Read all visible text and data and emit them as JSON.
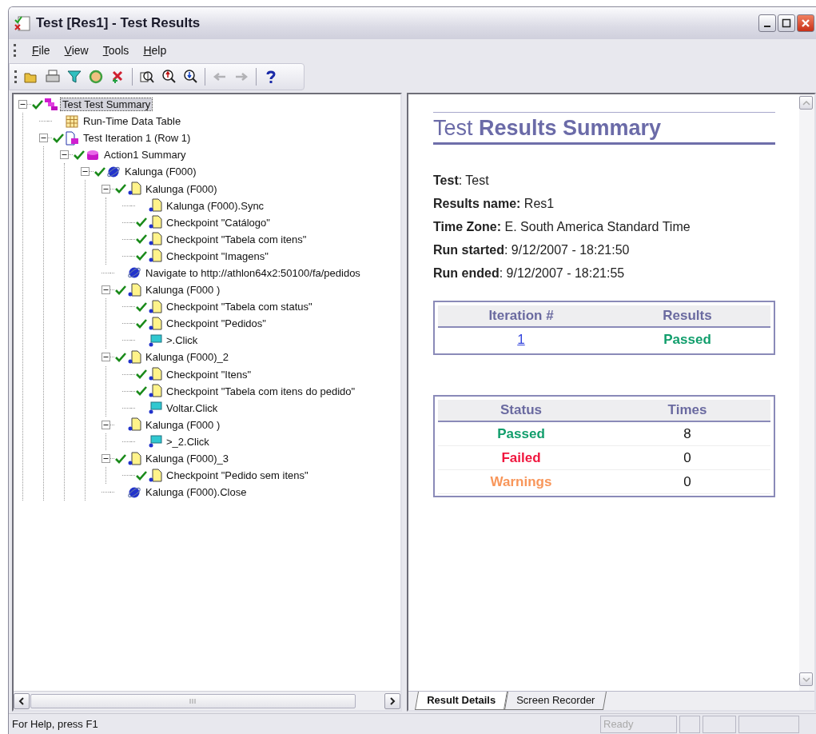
{
  "window": {
    "title": "Test [Res1] - Test Results"
  },
  "menu": [
    {
      "label": "File",
      "underline_first": true
    },
    {
      "label": "View",
      "underline_first": true
    },
    {
      "label": "Tools",
      "underline_first": true
    },
    {
      "label": "Help",
      "underline_first": true
    }
  ],
  "toolbar": [
    {
      "kind": "open",
      "disabled": false
    },
    {
      "kind": "print",
      "disabled": false
    },
    {
      "kind": "filter",
      "disabled": false
    },
    {
      "kind": "target",
      "disabled": false
    },
    {
      "kind": "remove",
      "disabled": false
    },
    {
      "kind": "find",
      "disabled": false
    },
    {
      "kind": "zoom-up",
      "disabled": false
    },
    {
      "kind": "zoom-down",
      "disabled": false
    },
    {
      "kind": "back",
      "disabled": true
    },
    {
      "kind": "forward",
      "disabled": true
    },
    {
      "kind": "help",
      "disabled": false
    }
  ],
  "tree": [
    {
      "label": "Test Test Summary",
      "kind": "summary",
      "passed": true,
      "selected": true,
      "expanded": true,
      "children": [
        {
          "label": "Run-Time Data Table",
          "kind": "table",
          "passed": false,
          "selected": false
        },
        {
          "label": "Test Iteration 1 (Row 1)",
          "kind": "iteration",
          "passed": true,
          "selected": false,
          "expanded": true,
          "children": [
            {
              "label": "Action1 Summary",
              "kind": "action",
              "passed": true,
              "selected": false,
              "expanded": true,
              "children": [
                {
                  "label": "Kalunga (F000)",
                  "kind": "browser",
                  "passed": true,
                  "selected": false,
                  "expanded": true,
                  "children": [
                    {
                      "label": "Kalunga (F000)",
                      "kind": "page",
                      "passed": true,
                      "selected": false,
                      "expanded": true,
                      "children": [
                        {
                          "label": "Kalunga (F000).Sync",
                          "kind": "page",
                          "passed": false,
                          "selected": false
                        },
                        {
                          "label": "Checkpoint \"Catálogo\"",
                          "kind": "page",
                          "passed": true,
                          "selected": false
                        },
                        {
                          "label": "Checkpoint \"Tabela com itens\"",
                          "kind": "page",
                          "passed": true,
                          "selected": false
                        },
                        {
                          "label": "Checkpoint \"Imagens\"",
                          "kind": "page",
                          "passed": true,
                          "selected": false
                        }
                      ]
                    },
                    {
                      "label": "Navigate to http://athlon64x2:50100/fa/pedidos",
                      "kind": "browser",
                      "passed": false,
                      "selected": false
                    },
                    {
                      "label": "Kalunga (F000 )",
                      "kind": "page",
                      "passed": true,
                      "selected": false,
                      "expanded": true,
                      "children": [
                        {
                          "label": "Checkpoint \"Tabela com status\"",
                          "kind": "page",
                          "passed": true,
                          "selected": false
                        },
                        {
                          "label": "Checkpoint \"Pedidos\"",
                          "kind": "page",
                          "passed": true,
                          "selected": false
                        },
                        {
                          "label": ">.Click",
                          "kind": "button",
                          "passed": false,
                          "selected": false
                        }
                      ]
                    },
                    {
                      "label": "Kalunga (F000)_2",
                      "kind": "page",
                      "passed": true,
                      "selected": false,
                      "expanded": true,
                      "children": [
                        {
                          "label": "Checkpoint \"Itens\"",
                          "kind": "page",
                          "passed": true,
                          "selected": false
                        },
                        {
                          "label": "Checkpoint \"Tabela com itens do pedido\"",
                          "kind": "page",
                          "passed": true,
                          "selected": false
                        },
                        {
                          "label": "Voltar.Click",
                          "kind": "button",
                          "passed": false,
                          "selected": false
                        }
                      ]
                    },
                    {
                      "label": "Kalunga (F000 )",
                      "kind": "page",
                      "passed": false,
                      "selected": false,
                      "expanded": true,
                      "children": [
                        {
                          "label": ">_2.Click",
                          "kind": "button",
                          "passed": false,
                          "selected": false
                        }
                      ]
                    },
                    {
                      "label": "Kalunga (F000)_3",
                      "kind": "page",
                      "passed": true,
                      "selected": false,
                      "expanded": true,
                      "children": [
                        {
                          "label": "Checkpoint \"Pedido sem itens\"",
                          "kind": "page",
                          "passed": true,
                          "selected": false
                        }
                      ]
                    },
                    {
                      "label": "Kalunga (F000).Close",
                      "kind": "browser",
                      "passed": false,
                      "selected": false
                    }
                  ]
                }
              ]
            }
          ]
        }
      ]
    }
  ],
  "summary": {
    "title": "Test **Results Summary**",
    "details": [
      "**Test**: Test",
      "**Results name:** Res1",
      "**Time Zone:** E. South America Standard Time",
      "**Run started**: 9/12/2007 - 18:21:50",
      "**Run ended**: 9/12/2007 - 18:21:55"
    ],
    "iterations": {
      "columns": [
        "Iteration #",
        "Results"
      ],
      "rows": [
        {
          "iteration": "1",
          "result": "Passed",
          "color": "#119e6c"
        }
      ]
    },
    "status": {
      "columns": [
        "Status",
        "Times"
      ],
      "rows": [
        {
          "status": "Passed",
          "times": "8",
          "color": "#119e6c"
        },
        {
          "status": "Failed",
          "times": "0",
          "color": "#f0163e"
        },
        {
          "status": "Warnings",
          "times": "0",
          "color": "#f8965a"
        }
      ]
    }
  },
  "tabs": [
    {
      "label": "Result Details",
      "selected": true
    },
    {
      "label": "Screen Recorder",
      "selected": false
    }
  ],
  "status_bar": {
    "message": "For Help, press F1",
    "state": "Ready"
  }
}
